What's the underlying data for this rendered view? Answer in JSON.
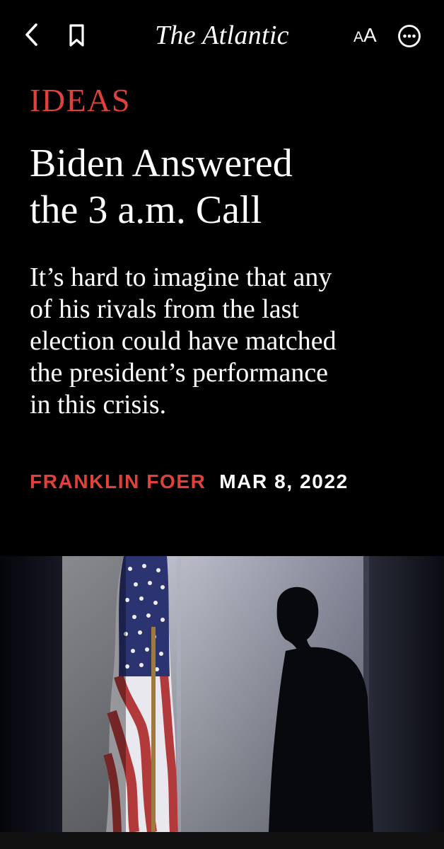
{
  "topbar": {
    "back_icon": "chevron-left-icon",
    "bookmark_icon": "bookmark-icon",
    "brand": "The Atlantic",
    "text_size_small": "A",
    "text_size_large": "A",
    "more_icon": "ellipsis-circle-icon"
  },
  "article": {
    "kicker": "IDEAS",
    "headline_line1": "Biden Answered",
    "headline_line2": "the 3 a.m. Call",
    "dek_lines": [
      "It’s hard to imagine that any",
      "of his rivals from the last",
      "election could have matched",
      "the president’s performance",
      "in this crisis."
    ],
    "author": "FRANKLIN FOER",
    "date": "MAR 8, 2022"
  },
  "colors": {
    "background": "#000000",
    "accent": "#e0423b",
    "text": "#ffffff"
  }
}
